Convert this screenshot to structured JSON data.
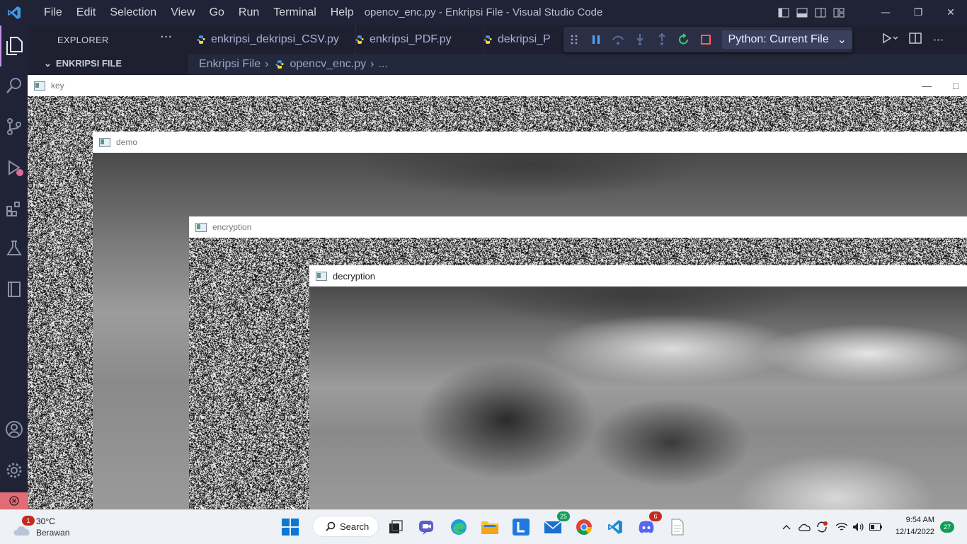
{
  "window": {
    "title": "opencv_enc.py - Enkripsi File - Visual Studio Code",
    "menu": [
      "File",
      "Edit",
      "Selection",
      "View",
      "Go",
      "Run",
      "Terminal",
      "Help"
    ]
  },
  "sidebar": {
    "header": "EXPLORER",
    "section": "ENKRIPSI FILE"
  },
  "tabs": [
    {
      "label": "enkripsi_dekripsi_CSV.py"
    },
    {
      "label": "enkripsi_PDF.py"
    },
    {
      "label": "dekripsi_P"
    }
  ],
  "breadcrumb": {
    "folder": "Enkripsi File",
    "file": "opencv_enc.py",
    "more": "..."
  },
  "debug": {
    "configuration": "Python: Current File"
  },
  "cv_windows": {
    "key": "key",
    "demo": "demo",
    "encryption": "encryption",
    "decryption": "decryption"
  },
  "taskbar": {
    "weather_temp": "30°C",
    "weather_desc": "Berawan",
    "weather_badge": "1",
    "search_label": "Search",
    "mail_badge": "25",
    "discord_badge": "6",
    "time": "9:54 AM",
    "date": "12/14/2022",
    "notification_count": "27"
  },
  "colors": {
    "accent": "#c792ea",
    "debug_bg": "#2b2f45"
  }
}
